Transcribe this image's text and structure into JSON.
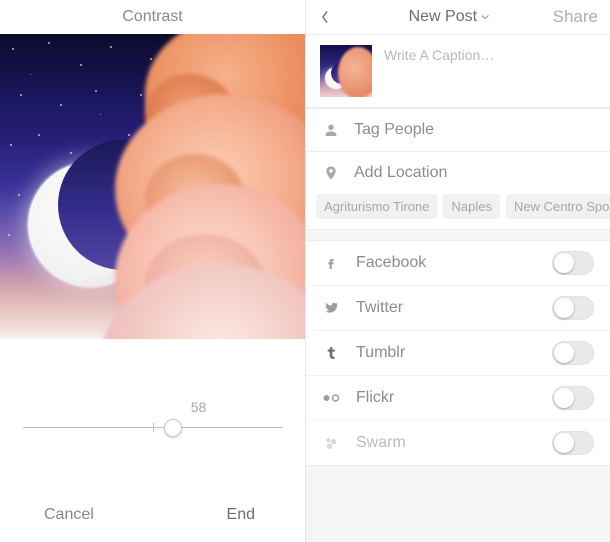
{
  "left": {
    "title": "Contrast",
    "slider": {
      "value": 58,
      "min": 0,
      "max": 100,
      "center_tick": 50,
      "thumb_pct": 58
    },
    "cancel_label": "Cancel",
    "end_label": "End"
  },
  "right": {
    "back_icon": "chevron-left-icon",
    "title": "New Post",
    "title_caret": "chevron-down-icon",
    "share_label": "Share",
    "caption_placeholder": "Write A Caption…",
    "tag_people_label": "Tag People",
    "add_location_label": "Add Location",
    "location_chips": [
      "Agriturismo Tirone",
      "Naples",
      "New Centro Sport I"
    ],
    "share_targets": [
      {
        "key": "facebook",
        "label": "Facebook",
        "on": false,
        "enabled": true
      },
      {
        "key": "twitter",
        "label": "Twitter",
        "on": false,
        "enabled": true
      },
      {
        "key": "tumblr",
        "label": "Tumblr",
        "on": false,
        "enabled": true
      },
      {
        "key": "flickr",
        "label": "Flickr",
        "on": false,
        "enabled": true
      },
      {
        "key": "swarm",
        "label": "Swarm",
        "on": false,
        "enabled": false
      }
    ]
  },
  "colors": {
    "muted_text": "#8c8c8c",
    "disabled_text": "#bcbcbc"
  }
}
